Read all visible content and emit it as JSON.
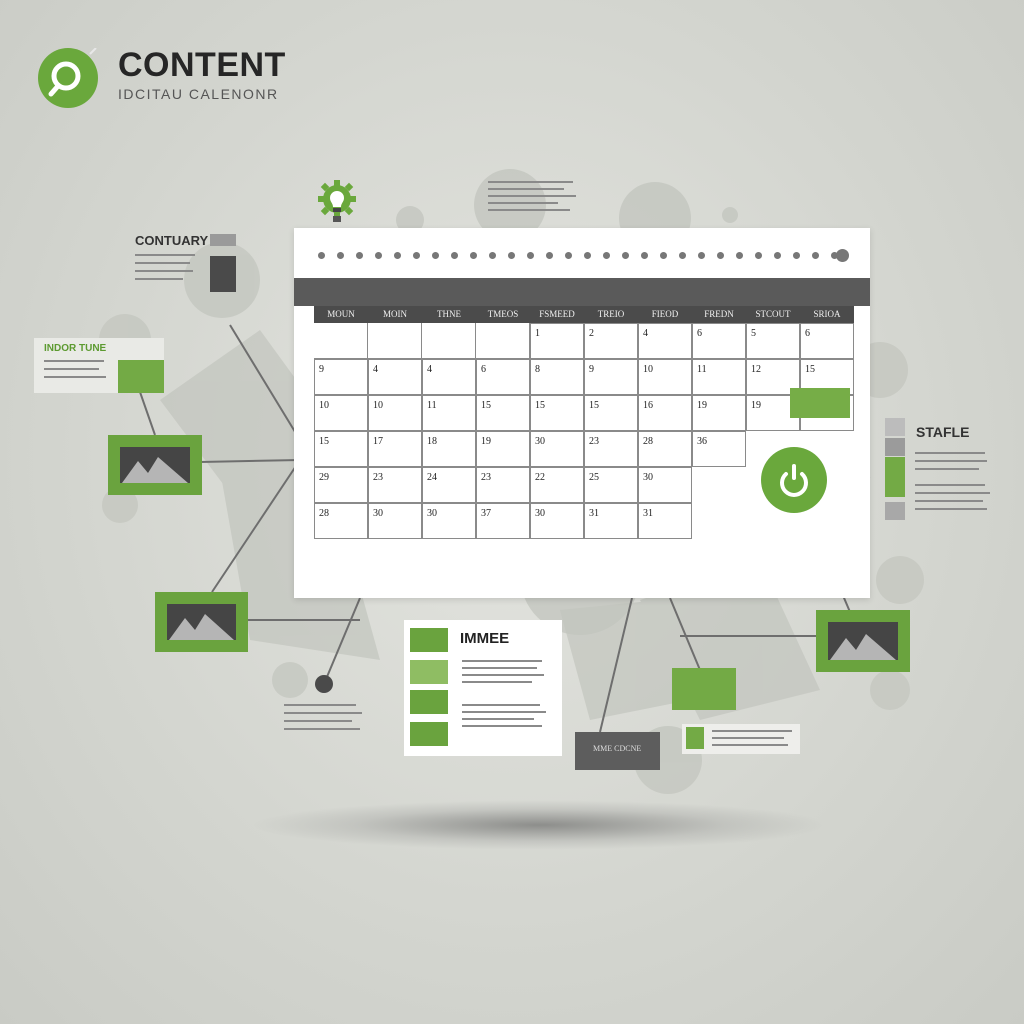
{
  "brand": {
    "title": "CONTENT",
    "subtitle": "IDCITAU CALENONR"
  },
  "labels": {
    "contuary": "CONTUARY",
    "indor_tune": "INDOR TUNE",
    "stafle": "STAFLE",
    "immee": "IMMEE"
  },
  "dark_tag": {
    "text": "MME CDCNE"
  },
  "calendar": {
    "weekdays": [
      "MOUN",
      "MOIN",
      "THNE",
      "TMEOS",
      "FSMEED",
      "TREIO",
      "FIEOD",
      "FREDN",
      "STCOUT",
      "SRIOA"
    ],
    "rows": [
      [
        "",
        "",
        "",
        "",
        "1",
        "2",
        "4",
        "6",
        "5",
        "6"
      ],
      [
        "9",
        "4",
        "4",
        "6",
        "8",
        "9",
        "10",
        "11",
        "12",
        "15"
      ],
      [
        "10",
        "10",
        "11",
        "15",
        "15",
        "15",
        "16",
        "19",
        "19",
        ""
      ],
      [
        "15",
        "17",
        "18",
        "19",
        "30",
        "23",
        "28",
        "36",
        "",
        ""
      ],
      [
        "29",
        "23",
        "24",
        "23",
        "22",
        "25",
        "30",
        "",
        "",
        ""
      ],
      [
        "28",
        "30",
        "30",
        "37",
        "30",
        "31",
        "31",
        "",
        "",
        ""
      ]
    ]
  },
  "colors": {
    "accent": "#72ab44",
    "dark": "#4b4b4b",
    "card": "#ffffff",
    "background": "#d8dad4"
  },
  "icons": [
    "search-icon",
    "lightbulb-gear-icon",
    "power-icon",
    "mountain-image-icon"
  ]
}
